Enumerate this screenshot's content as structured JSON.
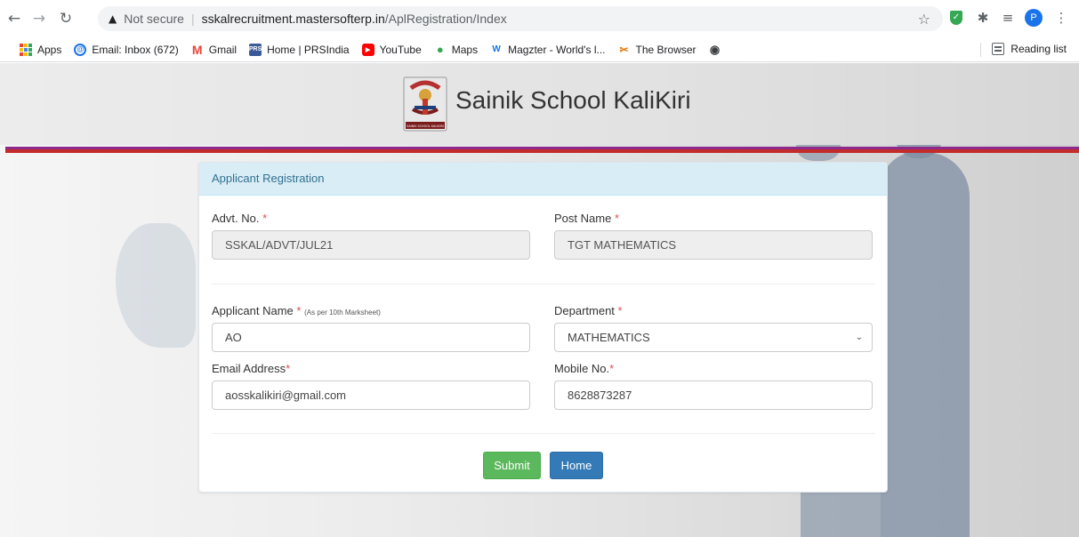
{
  "browser": {
    "security_label": "Not secure",
    "url_host": "sskalrecruitment.mastersofterp.in",
    "url_path": "/AplRegistration/Index",
    "profile_initial": "P",
    "bookmarks": [
      {
        "label": "Apps",
        "icon": "apps-grid-icon"
      },
      {
        "label": "Email: Inbox (672)",
        "icon": "email-icon"
      },
      {
        "label": "Gmail",
        "icon": "gmail-icon"
      },
      {
        "label": "Home | PRSIndia",
        "icon": "prs-icon"
      },
      {
        "label": "YouTube",
        "icon": "youtube-icon"
      },
      {
        "label": "Maps",
        "icon": "maps-icon"
      },
      {
        "label": "Magzter - World's l...",
        "icon": "magzter-icon"
      },
      {
        "label": "The Browser",
        "icon": "the-browser-icon"
      },
      {
        "label": "",
        "icon": "globe-icon"
      }
    ],
    "reading_list": "Reading list"
  },
  "site": {
    "title": "Sainik School KaliKiri",
    "logo_caption": "SAINIK SCHOOL KALIKIRI"
  },
  "form": {
    "heading": "Applicant Registration",
    "advt_label": "Advt. No.",
    "advt_value": "SSKAL/ADVT/JUL21",
    "post_label": "Post Name",
    "post_value": "TGT MATHEMATICS",
    "name_label": "Applicant Name",
    "name_note": "(As per 10th Marksheet)",
    "name_value": "AO",
    "dept_label": "Department",
    "dept_value": "MATHEMATICS",
    "email_label": "Email Address",
    "email_value": "aosskalikiri@gmail.com",
    "mobile_label": "Mobile No.",
    "mobile_value": "8628873287",
    "required_mark": "*",
    "submit_label": "Submit",
    "home_label": "Home"
  },
  "colors": {
    "panel_heading_bg": "#d9edf7",
    "panel_heading_text": "#31708f",
    "submit_bg": "#5cb85c",
    "home_bg": "#337ab7",
    "header_rule_purple": "#8e2a8c",
    "header_rule_red": "#c42c2c"
  }
}
